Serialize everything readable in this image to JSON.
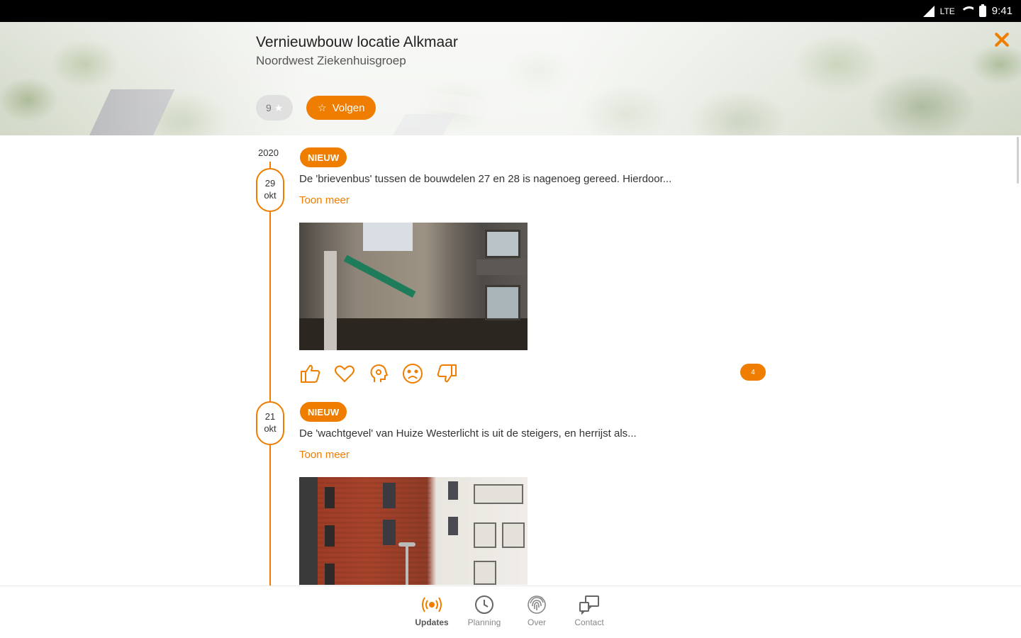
{
  "status_bar": {
    "network": "LTE",
    "time": "9:41"
  },
  "header": {
    "title": "Vernieuwbouw locatie Alkmaar",
    "subtitle": "Noordwest Ziekenhuisgroep",
    "followers_count": "9",
    "follow_label": "Volgen"
  },
  "feed": {
    "year": "2020",
    "posts": [
      {
        "day": "29",
        "month": "okt",
        "tag": "NIEUW",
        "text": "De 'brievenbus' tussen de bouwdelen 27 en 28 is nagenoeg gereed. Hierdoor...",
        "more_label": "Toon meer",
        "reaction_count": "4"
      },
      {
        "day": "21",
        "month": "okt",
        "tag": "NIEUW",
        "text": "De 'wachtgevel' van Huize Westerlicht is uit de steigers, en herrijst als...",
        "more_label": "Toon meer"
      }
    ],
    "reactions": [
      "thumbs-up",
      "heart",
      "idea",
      "sad",
      "thumbs-down"
    ]
  },
  "bottom_nav": {
    "items": [
      {
        "label": "Updates",
        "icon": "broadcast-icon",
        "active": true
      },
      {
        "label": "Planning",
        "icon": "clock-icon",
        "active": false
      },
      {
        "label": "Over",
        "icon": "fingerprint-icon",
        "active": false
      },
      {
        "label": "Contact",
        "icon": "contact-icon",
        "active": false
      }
    ]
  },
  "colors": {
    "accent": "#ef7d00",
    "text": "#333333",
    "muted": "#888888"
  }
}
